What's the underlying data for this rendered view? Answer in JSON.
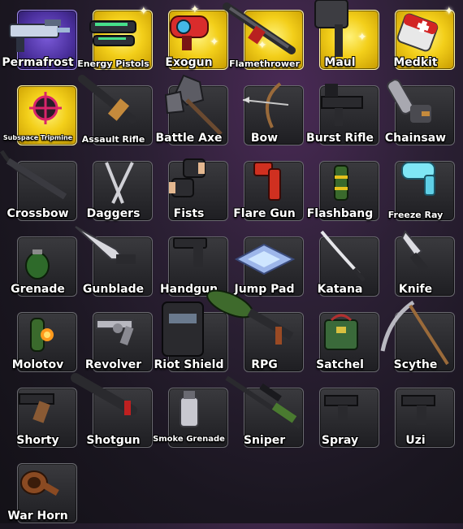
{
  "inventory": {
    "items": [
      {
        "name": "Permafrost",
        "tier": "purple"
      },
      {
        "name": "Energy Pistols",
        "tier": "gold"
      },
      {
        "name": "Exogun",
        "tier": "gold"
      },
      {
        "name": "Flamethrower",
        "tier": "gold"
      },
      {
        "name": "Maul",
        "tier": "gold"
      },
      {
        "name": "Medkit",
        "tier": "gold"
      },
      {
        "name": "Subspace Tripmine",
        "tier": "gold"
      },
      {
        "name": "Assault Rifle",
        "tier": "normal"
      },
      {
        "name": "Battle Axe",
        "tier": "normal"
      },
      {
        "name": "Bow",
        "tier": "normal"
      },
      {
        "name": "Burst Rifle",
        "tier": "normal"
      },
      {
        "name": "Chainsaw",
        "tier": "normal"
      },
      {
        "name": "Crossbow",
        "tier": "normal"
      },
      {
        "name": "Daggers",
        "tier": "normal"
      },
      {
        "name": "Fists",
        "tier": "normal"
      },
      {
        "name": "Flare Gun",
        "tier": "normal"
      },
      {
        "name": "Flashbang",
        "tier": "normal"
      },
      {
        "name": "Freeze Ray",
        "tier": "normal"
      },
      {
        "name": "Grenade",
        "tier": "normal"
      },
      {
        "name": "Gunblade",
        "tier": "normal"
      },
      {
        "name": "Handgun",
        "tier": "normal"
      },
      {
        "name": "Jump Pad",
        "tier": "normal"
      },
      {
        "name": "Katana",
        "tier": "normal"
      },
      {
        "name": "Knife",
        "tier": "normal"
      },
      {
        "name": "Molotov",
        "tier": "normal"
      },
      {
        "name": "Revolver",
        "tier": "normal"
      },
      {
        "name": "Riot Shield",
        "tier": "normal"
      },
      {
        "name": "RPG",
        "tier": "normal"
      },
      {
        "name": "Satchel",
        "tier": "normal"
      },
      {
        "name": "Scythe",
        "tier": "normal"
      },
      {
        "name": "Shorty",
        "tier": "normal"
      },
      {
        "name": "Shotgun",
        "tier": "normal"
      },
      {
        "name": "Smoke Grenade",
        "tier": "normal"
      },
      {
        "name": "Sniper",
        "tier": "normal"
      },
      {
        "name": "Spray",
        "tier": "normal"
      },
      {
        "name": "Uzi",
        "tier": "normal"
      },
      {
        "name": "War Horn",
        "tier": "normal"
      }
    ]
  },
  "colors": {
    "gold_tile": "#f3cf1a",
    "purple_tile": "#4a2f9c",
    "normal_tile": "#2a2a2e",
    "label_text": "#ffffff"
  }
}
